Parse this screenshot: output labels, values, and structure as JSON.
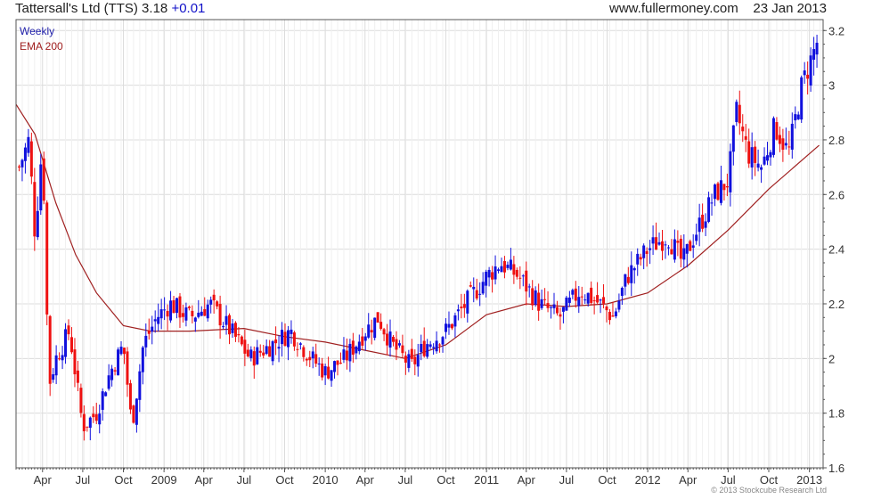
{
  "header": {
    "title": "Tattersall's Ltd (TTS) 3.18",
    "change": "+0.01",
    "site": "www.fullermoney.com",
    "date": "23 Jan 2013"
  },
  "legend": {
    "weekly": "Weekly",
    "ema": "EMA 200"
  },
  "footer": {
    "copyright": "© 2013 Stockcube Research Ltd"
  },
  "colors": {
    "up": "#1010dd",
    "down": "#ee1111",
    "ema": "#a02020",
    "grid": "#dcdcdc",
    "frame": "#555555",
    "legend_weekly": "#2020aa",
    "legend_ema": "#a02020"
  },
  "chart_data": {
    "type": "candlestick",
    "title": "Tattersall's Ltd (TTS)",
    "y_axis_side": "right",
    "ylim": [
      1.6,
      3.24
    ],
    "yticks": [
      1.6,
      1.8,
      2.0,
      2.2,
      2.4,
      2.6,
      2.8,
      3.0,
      3.2
    ],
    "yticklabels": [
      "1.6",
      "1.8",
      "2",
      "2.2",
      "2.4",
      "2.6",
      "2.8",
      "3",
      "3.2"
    ],
    "xlim": [
      "2008-02-01",
      "2013-02-01"
    ],
    "xticks": [
      "2008-04-01",
      "2008-07-01",
      "2008-10-01",
      "2009-01-01",
      "2009-04-01",
      "2009-07-01",
      "2009-10-01",
      "2010-01-01",
      "2010-04-01",
      "2010-07-01",
      "2010-10-01",
      "2011-01-01",
      "2011-04-01",
      "2011-07-01",
      "2011-10-01",
      "2012-01-01",
      "2012-04-01",
      "2012-07-01",
      "2012-10-01",
      "2013-01-01"
    ],
    "xticklabels": [
      "Apr",
      "Jul",
      "Oct",
      "2009",
      "Apr",
      "Jul",
      "Oct",
      "2010",
      "Apr",
      "Jul",
      "Oct",
      "2011",
      "Apr",
      "Jul",
      "Oct",
      "2012",
      "Apr",
      "Jul",
      "Oct",
      "2013"
    ],
    "grid": true,
    "series": [
      {
        "name": "Weekly",
        "style": "candles",
        "note": "approximate weekly close path (high/low spread estimated)",
        "x": [
          "2008-02-08",
          "2008-03-01",
          "2008-03-15",
          "2008-04-01",
          "2008-04-15",
          "2008-05-01",
          "2008-06-01",
          "2008-07-01",
          "2008-08-01",
          "2008-09-01",
          "2008-10-01",
          "2008-10-20",
          "2008-11-15",
          "2008-12-15",
          "2009-01-15",
          "2009-03-01",
          "2009-04-15",
          "2009-06-01",
          "2009-07-15",
          "2009-09-01",
          "2009-10-15",
          "2009-12-01",
          "2010-01-01",
          "2010-02-15",
          "2010-04-01",
          "2010-05-01",
          "2010-06-01",
          "2010-07-15",
          "2010-08-15",
          "2010-10-01",
          "2010-11-15",
          "2011-01-01",
          "2011-02-01",
          "2011-03-15",
          "2011-05-01",
          "2011-06-15",
          "2011-08-01",
          "2011-09-15",
          "2011-10-15",
          "2011-11-15",
          "2012-01-01",
          "2012-02-15",
          "2012-03-20",
          "2012-04-15",
          "2012-06-01",
          "2012-07-01",
          "2012-07-20",
          "2012-08-15",
          "2012-09-15",
          "2012-10-15",
          "2012-11-15",
          "2012-12-15",
          "2013-01-23"
        ],
        "values": [
          2.7,
          2.8,
          2.45,
          2.8,
          1.9,
          2.0,
          2.1,
          1.75,
          1.8,
          1.95,
          2.05,
          1.75,
          2.05,
          2.15,
          2.2,
          2.15,
          2.2,
          2.1,
          2.0,
          2.05,
          2.1,
          2.0,
          1.95,
          2.0,
          2.1,
          2.15,
          2.05,
          1.97,
          2.05,
          2.1,
          2.2,
          2.3,
          2.35,
          2.3,
          2.2,
          2.15,
          2.25,
          2.2,
          2.15,
          2.3,
          2.4,
          2.45,
          2.35,
          2.45,
          2.6,
          2.65,
          2.9,
          2.75,
          2.7,
          2.85,
          2.75,
          3.0,
          3.18
        ]
      },
      {
        "name": "EMA 200",
        "style": "line",
        "x": [
          "2008-02-01",
          "2008-03-15",
          "2008-05-01",
          "2008-06-15",
          "2008-08-01",
          "2008-10-01",
          "2008-12-01",
          "2009-03-01",
          "2009-07-01",
          "2009-10-01",
          "2010-01-01",
          "2010-04-01",
          "2010-07-01",
          "2010-10-01",
          "2011-01-01",
          "2011-04-01",
          "2011-07-01",
          "2011-10-01",
          "2012-01-01",
          "2012-04-01",
          "2012-07-01",
          "2012-10-01",
          "2013-01-23"
        ],
        "values": [
          2.93,
          2.82,
          2.57,
          2.38,
          2.24,
          2.12,
          2.1,
          2.1,
          2.11,
          2.08,
          2.06,
          2.03,
          2.0,
          2.05,
          2.16,
          2.2,
          2.19,
          2.2,
          2.24,
          2.34,
          2.47,
          2.62,
          2.78
        ]
      }
    ]
  }
}
